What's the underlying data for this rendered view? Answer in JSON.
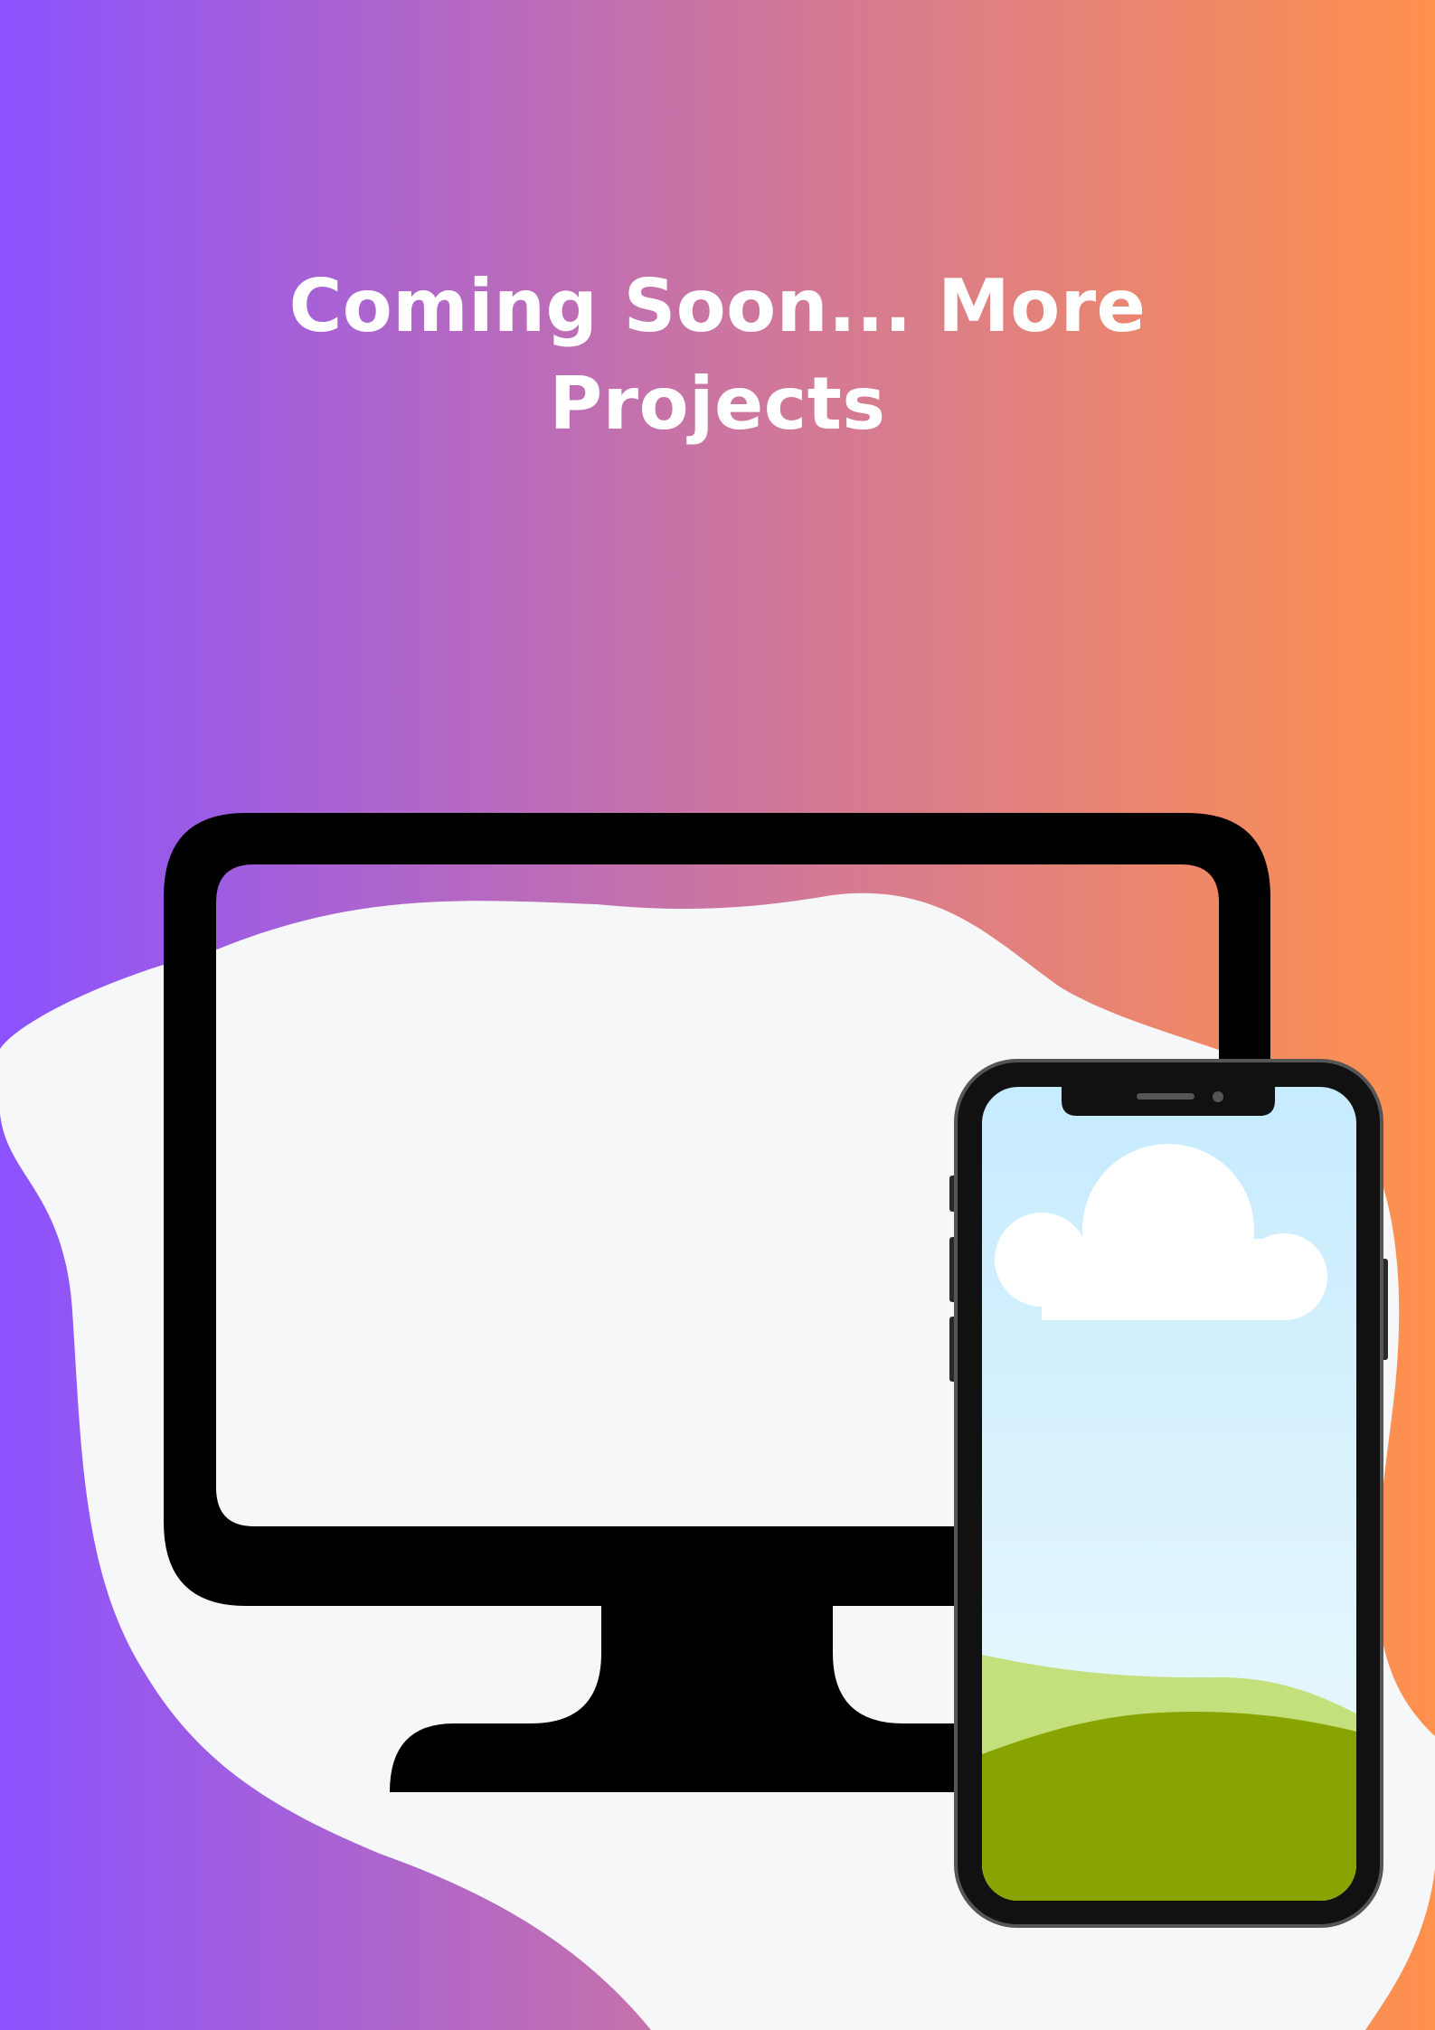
{
  "background": {
    "gradient_start": "#8B52FF",
    "gradient_mid": "#D17898",
    "gradient_end": "#FF914D",
    "blob_color": "#F6F7F8"
  },
  "headline": {
    "line1": "Coming Soon... More",
    "line2": "Projects"
  },
  "illustration": {
    "monitor_icon": "desktop-monitor-icon",
    "monitor_color": "#000000",
    "phone_icon": "smartphone-icon",
    "phone_frame_color": "#111111",
    "sky_top": "#C7EBFF",
    "sky_bottom": "#EDFAFC",
    "cloud_color": "#FFFFFF",
    "hill_light": "#C4E07C",
    "hill_dark": "#88A400"
  }
}
